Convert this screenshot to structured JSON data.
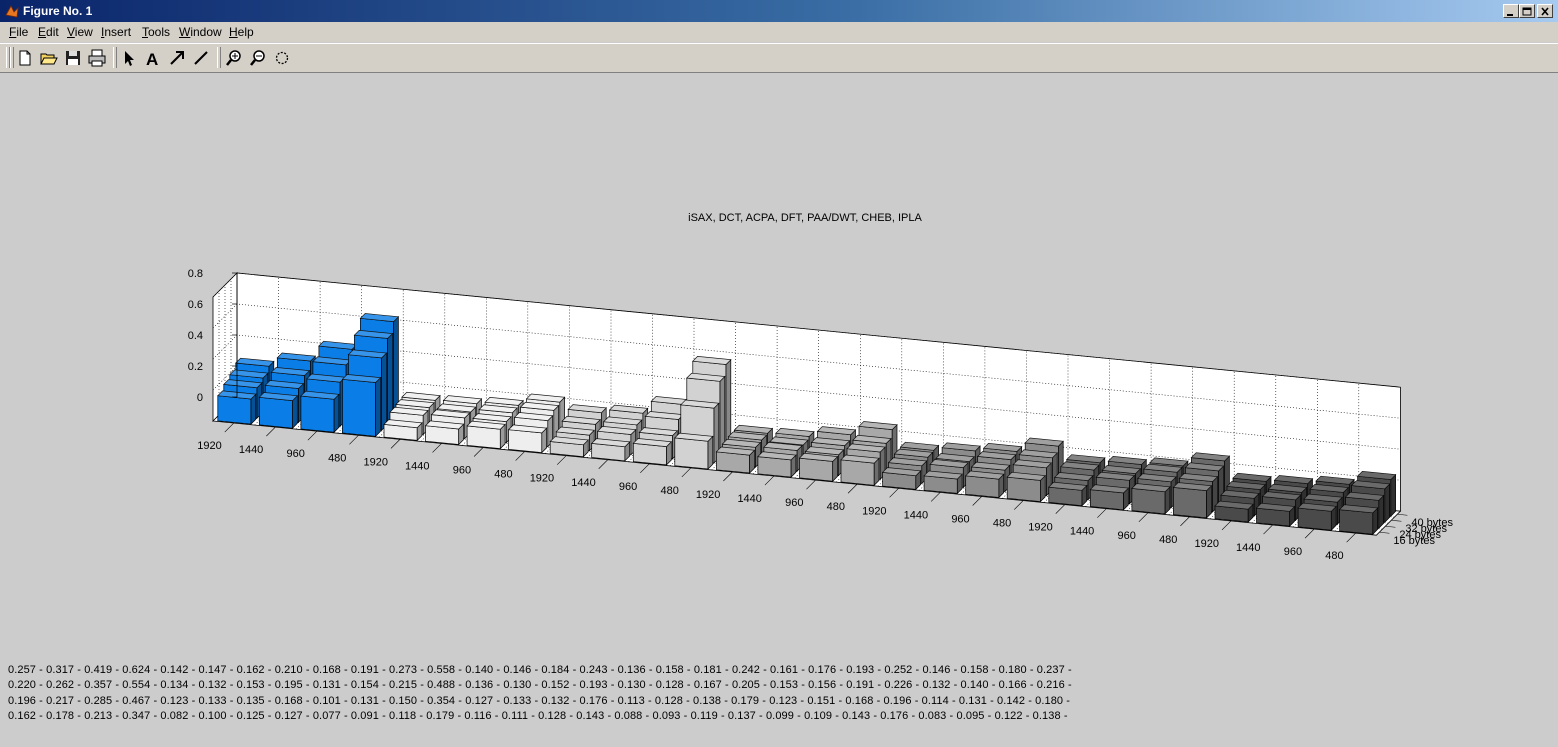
{
  "window": {
    "title": "Figure No. 1",
    "controls": [
      "minimize",
      "maximize",
      "close"
    ]
  },
  "menu": [
    "File",
    "Edit",
    "View",
    "Insert",
    "Tools",
    "Window",
    "Help"
  ],
  "toolbar": [
    {
      "icon": "new-figure-icon"
    },
    {
      "icon": "open-file-icon"
    },
    {
      "icon": "save-icon"
    },
    {
      "icon": "print-icon"
    },
    {
      "icon": "edit-plot-arrow-icon"
    },
    {
      "icon": "insert-text-icon"
    },
    {
      "icon": "insert-arrow-icon"
    },
    {
      "icon": "insert-line-icon"
    },
    {
      "icon": "zoom-in-icon"
    },
    {
      "icon": "zoom-out-icon"
    },
    {
      "icon": "rotate-3d-icon"
    }
  ],
  "chart_data": {
    "type": "bar3d",
    "title": "iSAX, DCT, ACPA, DFT, PAA/DWT, CHEB, IPLA",
    "zticks": [
      "0",
      "0.2",
      "0.4",
      "0.6",
      "0.8"
    ],
    "zlim": [
      0,
      0.8
    ],
    "xticks": [
      "1920",
      "1440",
      "960",
      "480",
      "1920",
      "1440",
      "960",
      "480",
      "1920",
      "1440",
      "960",
      "480",
      "1920",
      "1440",
      "960",
      "480",
      "1920",
      "1440",
      "960",
      "480",
      "1920",
      "1440",
      "960",
      "480",
      "1920",
      "1440",
      "960",
      "480"
    ],
    "yticks": [
      "16 bytes",
      "24 bytes",
      "32 bytes",
      "40 bytes"
    ],
    "grid": true,
    "groups": [
      {
        "color": "#0a7de6"
      },
      {
        "color": "#eeeeee"
      },
      {
        "color": "#d2d2d2"
      },
      {
        "color": "#a8a8a8"
      },
      {
        "color": "#8c8c8c"
      },
      {
        "color": "#6a6a6a"
      },
      {
        "color": "#4a4a4a"
      }
    ],
    "series": [
      {
        "name": "40 bytes",
        "values": [
          0.257,
          0.317,
          0.419,
          0.624,
          0.142,
          0.147,
          0.162,
          0.21,
          0.168,
          0.191,
          0.273,
          0.558,
          0.14,
          0.146,
          0.184,
          0.243,
          0.136,
          0.158,
          0.181,
          0.242,
          0.161,
          0.176,
          0.193,
          0.252,
          0.146,
          0.158,
          0.18,
          0.237
        ]
      },
      {
        "name": "32 bytes",
        "values": [
          0.22,
          0.262,
          0.357,
          0.554,
          0.134,
          0.132,
          0.153,
          0.195,
          0.131,
          0.154,
          0.215,
          0.488,
          0.136,
          0.13,
          0.152,
          0.193,
          0.13,
          0.128,
          0.167,
          0.205,
          0.153,
          0.156,
          0.191,
          0.226,
          0.132,
          0.14,
          0.166,
          0.216
        ]
      },
      {
        "name": "24 bytes",
        "values": [
          0.196,
          0.217,
          0.285,
          0.467,
          0.123,
          0.133,
          0.135,
          0.168,
          0.101,
          0.131,
          0.15,
          0.354,
          0.127,
          0.133,
          0.132,
          0.176,
          0.113,
          0.128,
          0.138,
          0.179,
          0.123,
          0.151,
          0.168,
          0.196,
          0.114,
          0.131,
          0.142,
          0.18
        ]
      },
      {
        "name": "16 bytes",
        "values": [
          0.162,
          0.178,
          0.213,
          0.347,
          0.082,
          0.1,
          0.125,
          0.127,
          0.077,
          0.091,
          0.118,
          0.179,
          0.116,
          0.111,
          0.128,
          0.143,
          0.088,
          0.093,
          0.119,
          0.137,
          0.099,
          0.109,
          0.143,
          0.176,
          0.083,
          0.095,
          0.122,
          0.138
        ]
      }
    ]
  },
  "value_lines": [
    "0.257 - 0.317 - 0.419 - 0.624 - 0.142 - 0.147 - 0.162 - 0.210 - 0.168 - 0.191 - 0.273 - 0.558 - 0.140 - 0.146 - 0.184 - 0.243 - 0.136 - 0.158 - 0.181 - 0.242 - 0.161 - 0.176 - 0.193 - 0.252 - 0.146 - 0.158 - 0.180 - 0.237 -",
    "0.220 - 0.262 - 0.357 - 0.554 - 0.134 - 0.132 - 0.153 - 0.195 - 0.131 - 0.154 - 0.215 - 0.488 - 0.136 - 0.130 - 0.152 - 0.193 - 0.130 - 0.128 - 0.167 - 0.205 - 0.153 - 0.156 - 0.191 - 0.226 - 0.132 - 0.140 - 0.166 - 0.216 -",
    "0.196 - 0.217 - 0.285 - 0.467 - 0.123 - 0.133 - 0.135 - 0.168 - 0.101 - 0.131 - 0.150 - 0.354 - 0.127 - 0.133 - 0.132 - 0.176 - 0.113 - 0.128 - 0.138 - 0.179 - 0.123 - 0.151 - 0.168 - 0.196 - 0.114 - 0.131 - 0.142 - 0.180 -",
    "0.162 - 0.178 - 0.213 - 0.347 - 0.082 - 0.100 - 0.125 - 0.127 - 0.077 - 0.091 - 0.118 - 0.179 - 0.116 - 0.111 - 0.128 - 0.143 - 0.088 - 0.093 - 0.119 - 0.137 - 0.099 - 0.109 - 0.143 - 0.176 - 0.083 - 0.095 - 0.122 - 0.138 -"
  ]
}
